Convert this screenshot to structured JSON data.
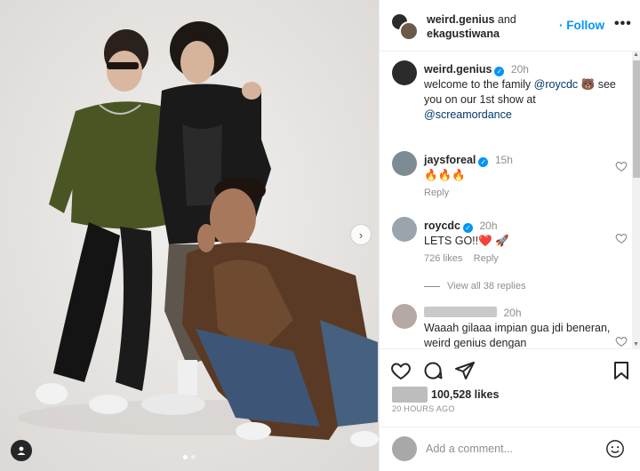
{
  "post": {
    "header": {
      "user1": "weird.genius",
      "joiner": "and",
      "user2": "ekagustiwana",
      "follow_label": "Follow",
      "more_label": "•••"
    },
    "caption": {
      "user": "weird.genius",
      "time": "20h",
      "text_1": "welcome to the family",
      "mention": "@roycdc",
      "text_2": "🐻 see you on our 1st show at",
      "mention_2": "@screamordance"
    },
    "comments": [
      {
        "user": "jaysforeal",
        "time": "15h",
        "text": "🔥🔥🔥",
        "reply_label": "Reply"
      },
      {
        "user": "roycdc",
        "time": "20h",
        "text": "LETS GO!!❤️ 🚀",
        "likes_label": "726 likes",
        "reply_label": "Reply",
        "view_replies": "View all 38 replies"
      },
      {
        "user": "",
        "time": "20h",
        "text": "Waaah gilaaa impian gua jdi beneran, weird genius dengan"
      }
    ],
    "likes": "100,528 likes",
    "time_ago": "20 HOURS AGO",
    "add_comment_placeholder": "Add a comment...",
    "carousel": {
      "total": 2,
      "active": 0
    }
  },
  "icons": {
    "next": "chevron-right-icon",
    "like": "heart-icon",
    "comment": "comment-icon",
    "share": "paper-plane-icon",
    "save": "bookmark-icon",
    "emoji": "smiley-icon",
    "tag": "user-tag-icon"
  },
  "colors": {
    "accent": "#0095f6",
    "muted": "#8e8e8e",
    "text": "#262626",
    "heart_red": "#ed4956"
  }
}
